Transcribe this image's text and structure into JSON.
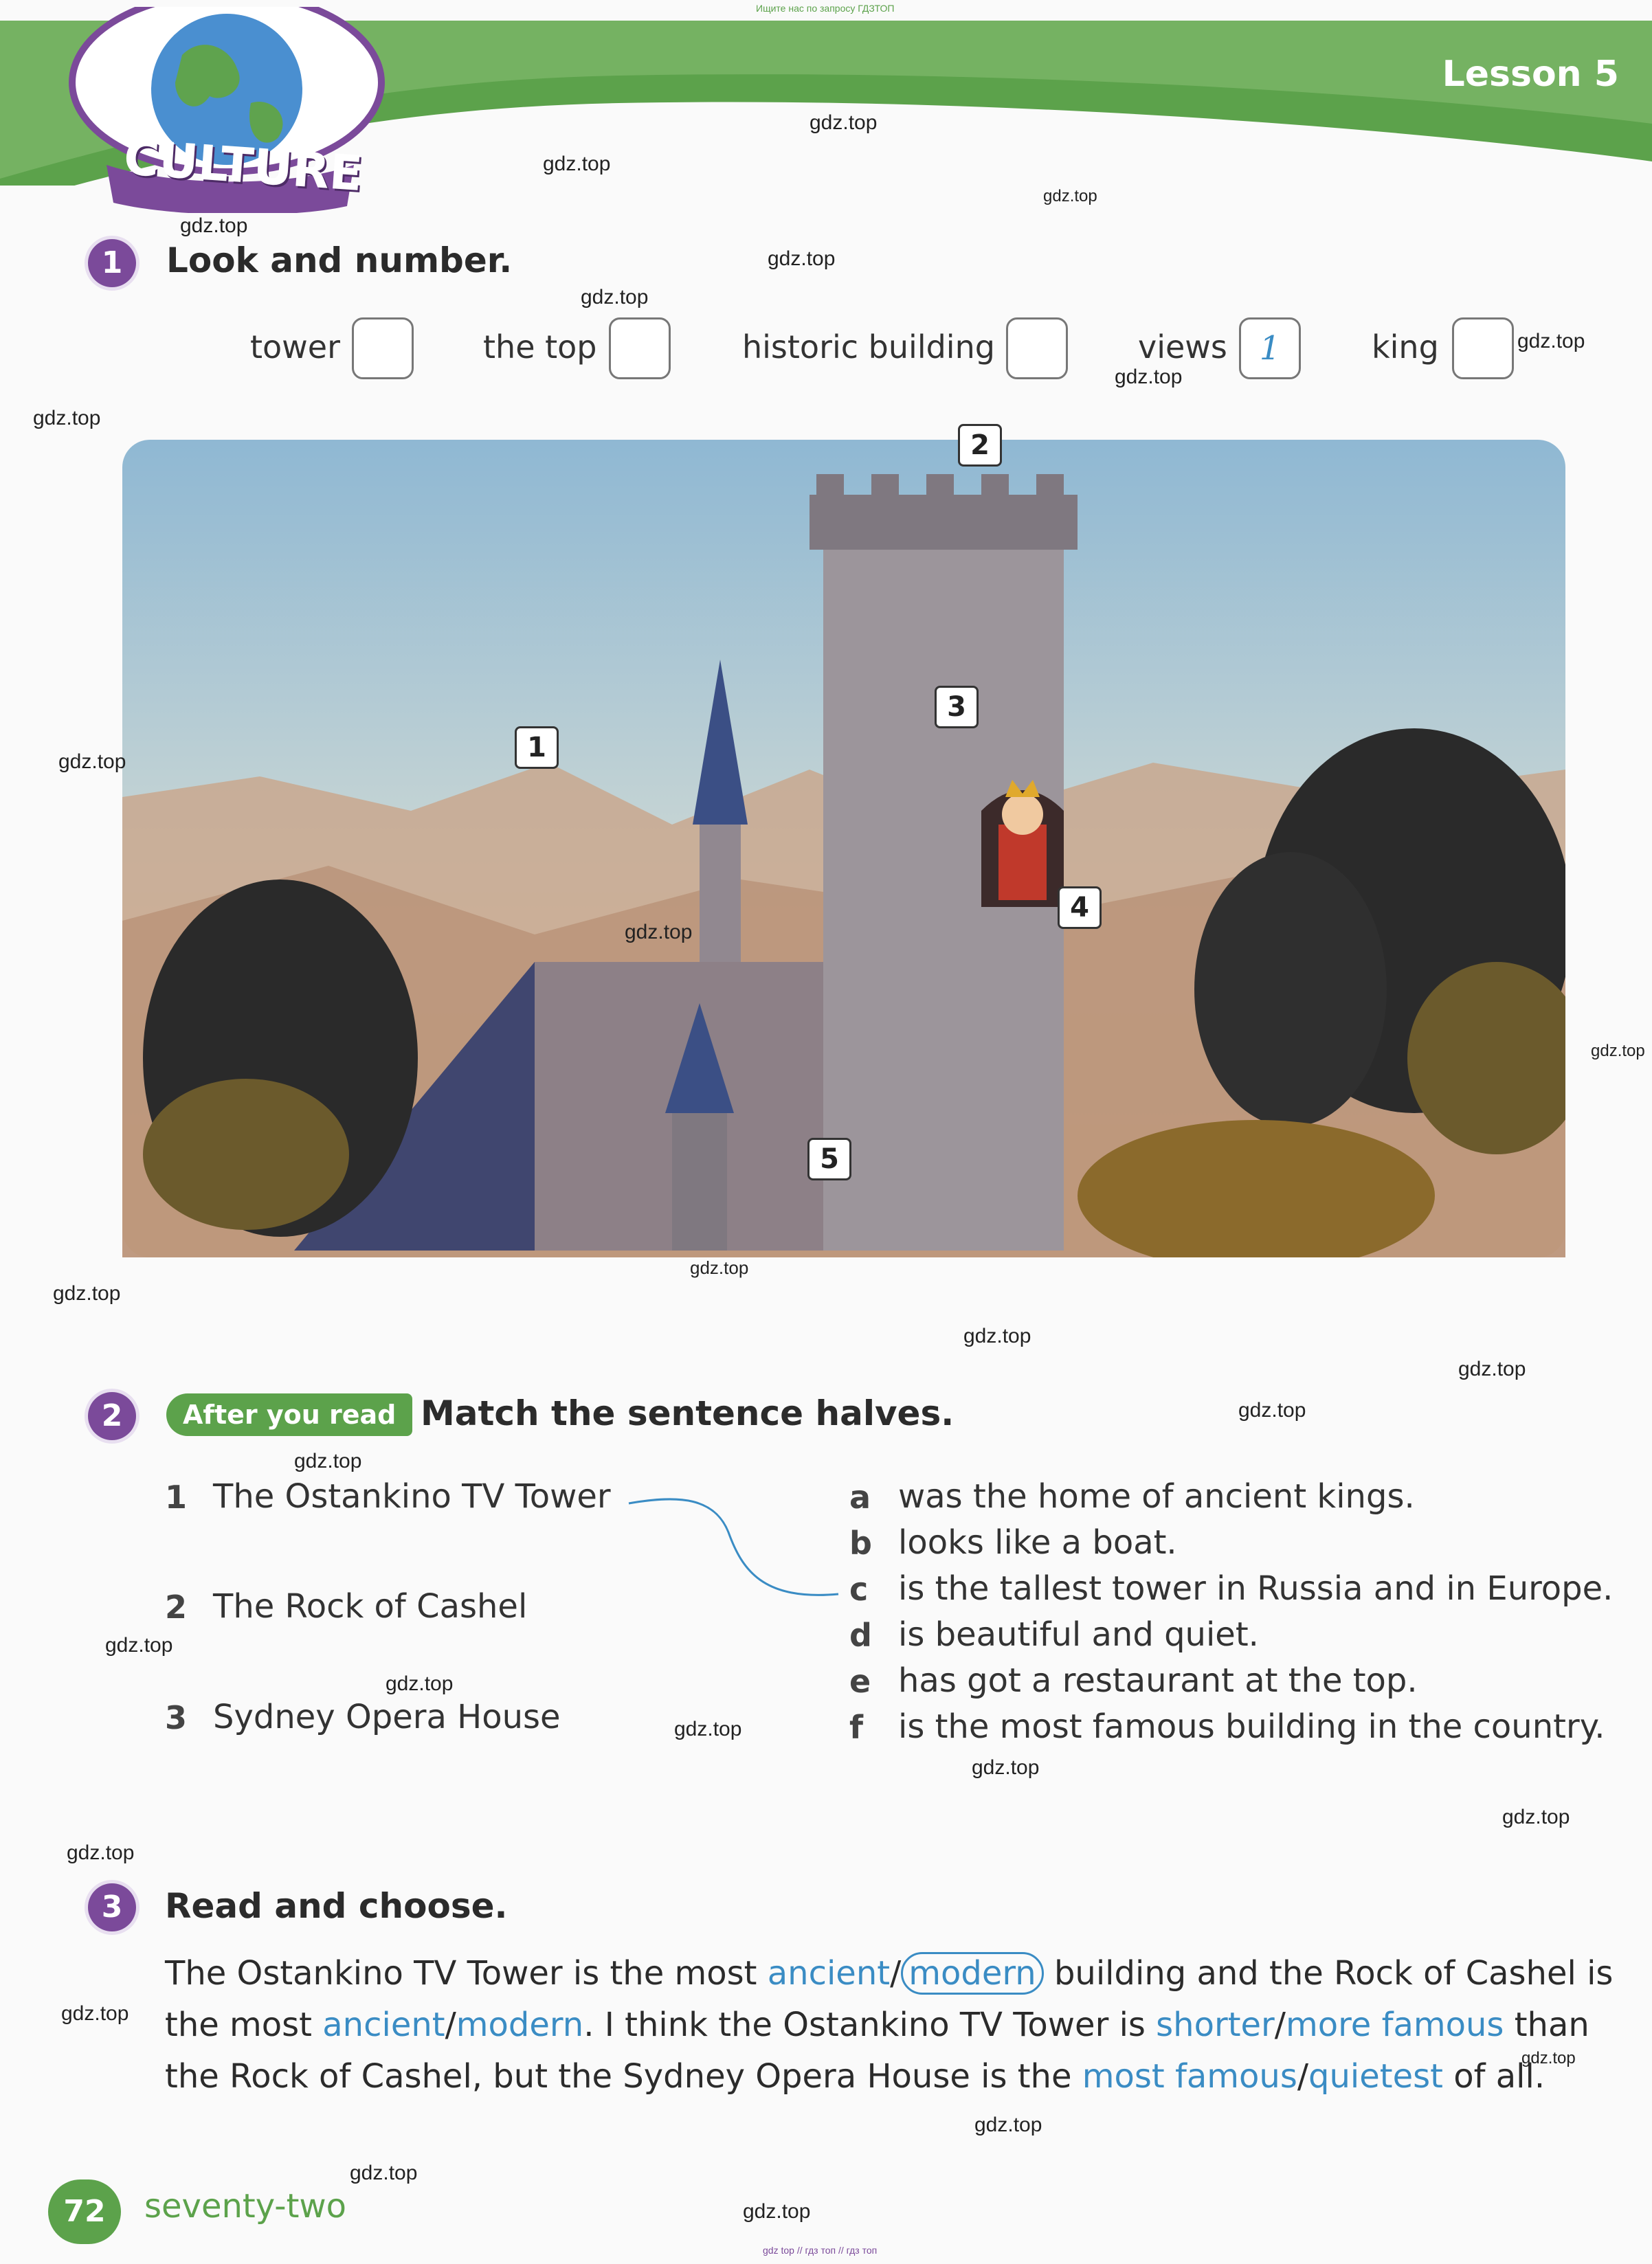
{
  "top_note": "Ищите нас по запросу ГДЗТОП",
  "bottom_note": "gdz top // гдз топ // гдз топ",
  "header": {
    "badge": "CULTURE",
    "lesson": "Lesson 5"
  },
  "exercise1": {
    "number": "1",
    "title": "Look and number.",
    "words": [
      {
        "label": "tower",
        "answer": ""
      },
      {
        "label": "the top",
        "answer": ""
      },
      {
        "label": "historic building",
        "answer": ""
      },
      {
        "label": "views",
        "answer": "1"
      },
      {
        "label": "king",
        "answer": ""
      }
    ],
    "picture_labels": [
      "1",
      "2",
      "3",
      "4",
      "5"
    ]
  },
  "exercise2": {
    "number": "2",
    "badge": "After you read",
    "title": "Match the sentence halves.",
    "left": [
      {
        "num": "1",
        "text": "The Ostankino TV Tower"
      },
      {
        "num": "2",
        "text": "The Rock of Cashel"
      },
      {
        "num": "3",
        "text": "Sydney Opera House"
      }
    ],
    "right": [
      {
        "letter": "a",
        "text": "was the home of ancient kings."
      },
      {
        "letter": "b",
        "text": "looks like a boat."
      },
      {
        "letter": "c",
        "text": "is the tallest tower in Russia and in Europe."
      },
      {
        "letter": "d",
        "text": "is beautiful and quiet."
      },
      {
        "letter": "e",
        "text": "has got a restaurant at the top."
      },
      {
        "letter": "f",
        "text": "is the most famous building in the country."
      }
    ]
  },
  "exercise3": {
    "number": "3",
    "title": "Read and choose.",
    "t1": "The Ostankino TV Tower is the most ",
    "o1a": "ancient",
    "s1": "/",
    "o1b": "modern",
    "t2": " building and the Rock of Cashel is the most ",
    "o2a": "ancient",
    "s2": "/",
    "o2b": "modern",
    "t3": ". I think the Ostankino TV Tower is ",
    "o3a": "shorter",
    "s3": "/",
    "o3b": "more famous",
    "t4": " than the Rock of Cashel, but the Sydney Opera House is the ",
    "o4a": "most famous",
    "s4": "/",
    "o4b": "quietest",
    "t5": " of all."
  },
  "footer": {
    "page_number": "72",
    "page_word": "seventy-two"
  },
  "watermarks": [
    "gdz.top",
    "gdz.top",
    "gdz.top",
    "gdz.top",
    "gdz.top",
    "gdz.top",
    "gdz.top",
    "gdz.top",
    "gdz.top",
    "gdz.top",
    "gdz.top",
    "gdz.top",
    "gdz.top",
    "gdz.top",
    "gdz.top",
    "gdz.top",
    "gdz.top",
    "gdz.top",
    "gdz.top",
    "gdz.top",
    "gdz.top",
    "gdz.top",
    "gdz.top",
    "gdz.top",
    "gdz.top",
    "gdz.top",
    "gdz.top",
    "gdz.top",
    "gdz.top",
    "gdz.top"
  ],
  "colors": {
    "accent_green": "#5ca24b",
    "accent_purple": "#7b4a9a",
    "answer_blue": "#3a8cc4"
  }
}
